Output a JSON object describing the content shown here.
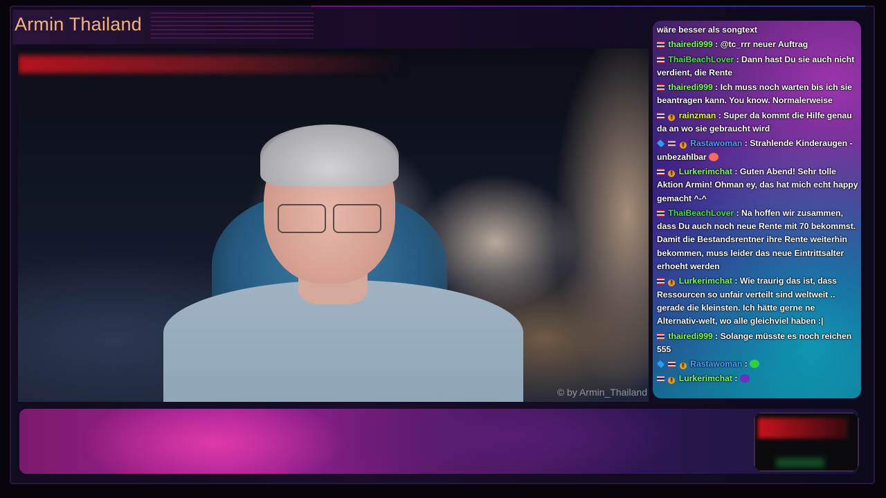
{
  "overlay": {
    "channel_title": "Armin Thailand",
    "watermark": "© by Armin_Thailand"
  },
  "colors": {
    "title": "#f5b27a",
    "user_green": "#7cff5a",
    "user_blue": "#4aa3ff",
    "user_yellow": "#e8ff3a"
  },
  "chat": {
    "messages": [
      {
        "badges": [],
        "user": "",
        "text": "wäre besser als songtext",
        "user_color": "#ffffff"
      },
      {
        "badges": [
          "flag-icon"
        ],
        "user": "thairedi999",
        "text": ": @tc_rrr neuer Auftrag",
        "user_color": "#7cff5a"
      },
      {
        "badges": [
          "flag-icon"
        ],
        "user": "ThaiBeachLover",
        "text": ": Dann hast Du sie auch nicht verdient, die Rente",
        "user_color": "#4adf4a"
      },
      {
        "badges": [
          "flag-icon"
        ],
        "user": "thairedi999",
        "text": ": Ich muss noch warten bis ich sie beantragen kann. You know. Normalerweise",
        "user_color": "#7cff5a"
      },
      {
        "badges": [
          "flag-icon",
          "coin-icon"
        ],
        "user": "rainzman",
        "text": ": Super da kommt die Hilfe genau da an wo sie gebraucht wird",
        "user_color": "#e8ff3a"
      },
      {
        "badges": [
          "cube-icon",
          "flag-icon",
          "coin-icon"
        ],
        "user": "Rastawoman",
        "text": ": Strahlende Kinderaugen - unbezahlbar",
        "user_color": "#4aa3ff",
        "emote": "heart-eyes-emote"
      },
      {
        "badges": [
          "flag-icon",
          "coin-icon"
        ],
        "user": "Lurkerimchat",
        "text": ": Guten Abend! Sehr tolle Aktion Armin! Ohman ey, das hat mich echt happy gemacht ^-^",
        "user_color": "#7cff5a"
      },
      {
        "badges": [
          "flag-icon"
        ],
        "user": "ThaiBeachLover",
        "text": ": Na hoffen wir zusammen, dass Du auch noch neue Rente mit 70 bekommst. Damit die Bestandsrentner ihre Rente weiterhin bekommen, muss leider das neue Eintrittsalter erhoeht werden",
        "user_color": "#4adf4a"
      },
      {
        "badges": [
          "flag-icon",
          "coin-icon"
        ],
        "user": "Lurkerimchat",
        "text": ": Wie traurig das ist, dass Ressourcen so unfair verteilt sind weltweit .. gerade die kleinsten. Ich hätte gerne ne Alternativ-welt, wo alle gleichviel haben :|",
        "user_color": "#7cff5a"
      },
      {
        "badges": [
          "flag-icon"
        ],
        "user": "thairedi999",
        "text": ": Solange müsste es noch reichen 555",
        "user_color": "#7cff5a"
      },
      {
        "badges": [
          "cube-icon",
          "flag-icon",
          "coin-icon"
        ],
        "user": "Rastawoman",
        "text": ":",
        "user_color": "#4aa3ff",
        "emote": "green-emote"
      },
      {
        "badges": [
          "flag-icon",
          "coin-icon"
        ],
        "user": "Lurkerimchat",
        "text": ":",
        "user_color": "#7cff5a",
        "emote": "purple-emote"
      }
    ]
  }
}
